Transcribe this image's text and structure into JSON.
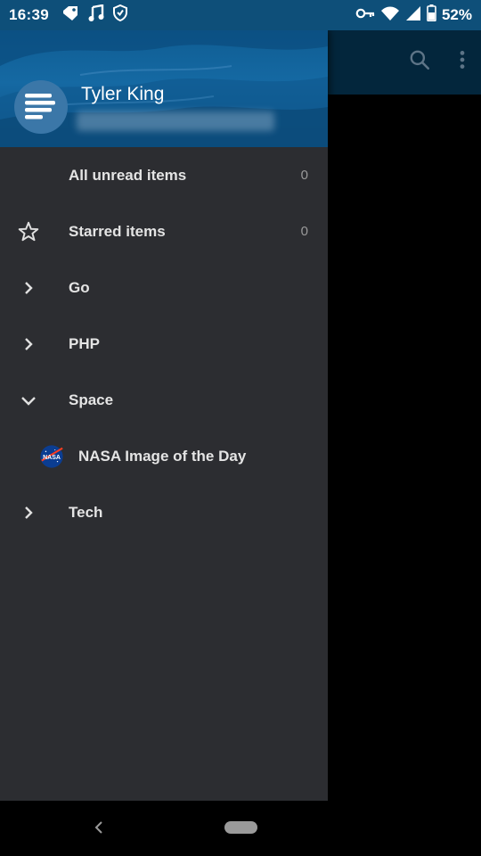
{
  "status_bar": {
    "time": "16:39",
    "battery": "52%",
    "icons": [
      "tag-icon",
      "music-note-icon",
      "shield-icon",
      "vpn-key-icon",
      "wifi-icon",
      "cell-signal-icon",
      "battery-icon"
    ]
  },
  "app_bar": {
    "actions": [
      "search-icon",
      "more-vert-icon"
    ]
  },
  "drawer": {
    "user_name": "Tyler King",
    "items": [
      {
        "label": "All unread items",
        "count": "0",
        "icon": "none"
      },
      {
        "label": "Starred items",
        "count": "0",
        "icon": "star-outline-icon"
      },
      {
        "label": "Go",
        "icon": "chevron-right-icon"
      },
      {
        "label": "PHP",
        "icon": "chevron-right-icon"
      },
      {
        "label": "Space",
        "icon": "chevron-down-icon"
      },
      {
        "label": "NASA Image of the Day",
        "icon": "nasa-logo-icon",
        "logo_text": "NASA"
      },
      {
        "label": "Tech",
        "icon": "chevron-right-icon"
      }
    ]
  },
  "colors": {
    "status_bar": "#0e4f79",
    "drawer_bg": "#2c2d31",
    "header_blue": "#1569a3"
  }
}
